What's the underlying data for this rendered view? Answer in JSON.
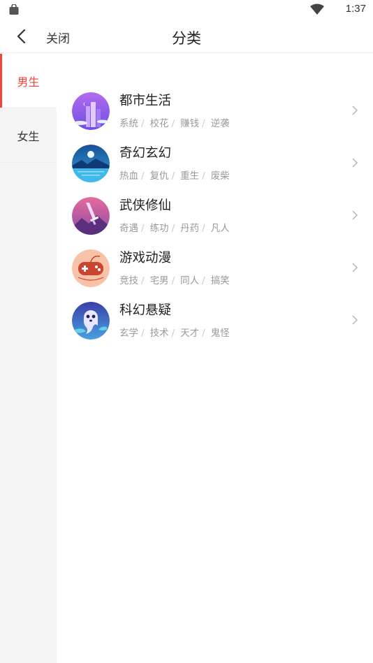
{
  "status_bar": {
    "time": "1:37",
    "icons": [
      "shopping-bag-icon",
      "wifi-icon"
    ]
  },
  "header": {
    "back_icon": "chevron-left-icon",
    "close_label": "关闭",
    "title": "分类"
  },
  "sidebar": {
    "items": [
      {
        "label": "男生",
        "active": true
      },
      {
        "label": "女生",
        "active": false
      }
    ]
  },
  "categories": [
    {
      "name": "都市生活",
      "tags": [
        "系统",
        "校花",
        "赚钱",
        "逆袭"
      ],
      "icon": "city-skyline-icon"
    },
    {
      "name": "奇幻玄幻",
      "tags": [
        "热血",
        "复仇",
        "重生",
        "废柴"
      ],
      "icon": "moonlit-lake-icon"
    },
    {
      "name": "武侠修仙",
      "tags": [
        "奇遇",
        "练功",
        "丹药",
        "凡人"
      ],
      "icon": "sword-mountain-icon"
    },
    {
      "name": "游戏动漫",
      "tags": [
        "竞技",
        "宅男",
        "同人",
        "搞笑"
      ],
      "icon": "gamepad-icon"
    },
    {
      "name": "科幻悬疑",
      "tags": [
        "玄学",
        "技术",
        "天才",
        "鬼怪"
      ],
      "icon": "ghost-icon"
    }
  ],
  "colors": {
    "accent": "#f0453d",
    "sidebar_bg": "#f5f5f5",
    "tag_text": "#9a9a9a"
  }
}
